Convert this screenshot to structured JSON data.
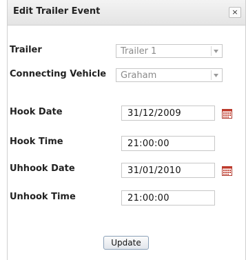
{
  "dialog": {
    "title": "Edit Trailer Event",
    "close_label": "×"
  },
  "form": {
    "trailer_label": "Trailer",
    "trailer_value": "Trailer 1",
    "vehicle_label": "Connecting Vehicle",
    "vehicle_value": "Graham",
    "hook_date_label": "Hook Date",
    "hook_date_value": "31/12/2009",
    "hook_time_label": "Hook Time",
    "hook_time_value": "21:00:00",
    "unhook_date_label": "Uhhook Date",
    "unhook_date_value": "31/01/2010",
    "unhook_time_label": "Unhook Time",
    "unhook_time_value": "21:00:00"
  },
  "actions": {
    "update_label": "Update"
  },
  "colors": {
    "calendar_icon": "#c0392b",
    "select_text": "#8a8a8a"
  }
}
